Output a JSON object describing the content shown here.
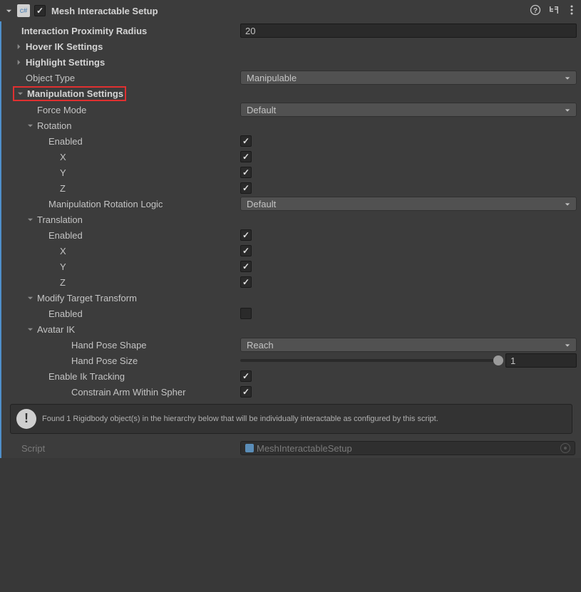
{
  "header": {
    "title": "Mesh Interactable Setup",
    "enabled": true
  },
  "fields": {
    "proximity": {
      "label": "Interaction Proximity Radius",
      "value": "20"
    },
    "hoverIK": {
      "label": "Hover IK Settings"
    },
    "highlight": {
      "label": "Highlight Settings"
    },
    "objectType": {
      "label": "Object Type",
      "value": "Manipulable"
    },
    "manipulation": {
      "label": "Manipulation Settings"
    },
    "forceMode": {
      "label": "Force Mode",
      "value": "Default"
    },
    "rotation": {
      "label": "Rotation",
      "enabled": {
        "label": "Enabled",
        "value": true
      },
      "x": {
        "label": "X",
        "value": true
      },
      "y": {
        "label": "Y",
        "value": true
      },
      "z": {
        "label": "Z",
        "value": true
      },
      "logic": {
        "label": "Manipulation Rotation Logic",
        "value": "Default"
      }
    },
    "translation": {
      "label": "Translation",
      "enabled": {
        "label": "Enabled",
        "value": true
      },
      "x": {
        "label": "X",
        "value": true
      },
      "y": {
        "label": "Y",
        "value": true
      },
      "z": {
        "label": "Z",
        "value": true
      }
    },
    "modifyTarget": {
      "label": "Modify Target Transform",
      "enabled": {
        "label": "Enabled",
        "value": false
      }
    },
    "avatarIK": {
      "label": "Avatar IK",
      "handPoseShape": {
        "label": "Hand Pose Shape",
        "value": "Reach"
      },
      "handPoseSize": {
        "label": "Hand Pose Size",
        "value": "1"
      },
      "enableTracking": {
        "label": "Enable Ik Tracking",
        "value": true
      },
      "constrainArm": {
        "label": "Constrain Arm Within Spher",
        "value": true
      }
    }
  },
  "infoMessage": "Found 1 Rigidbody object(s) in the hierarchy below that will be individually interactable as configured by this script.",
  "script": {
    "label": "Script",
    "value": "MeshInteractableSetup"
  }
}
